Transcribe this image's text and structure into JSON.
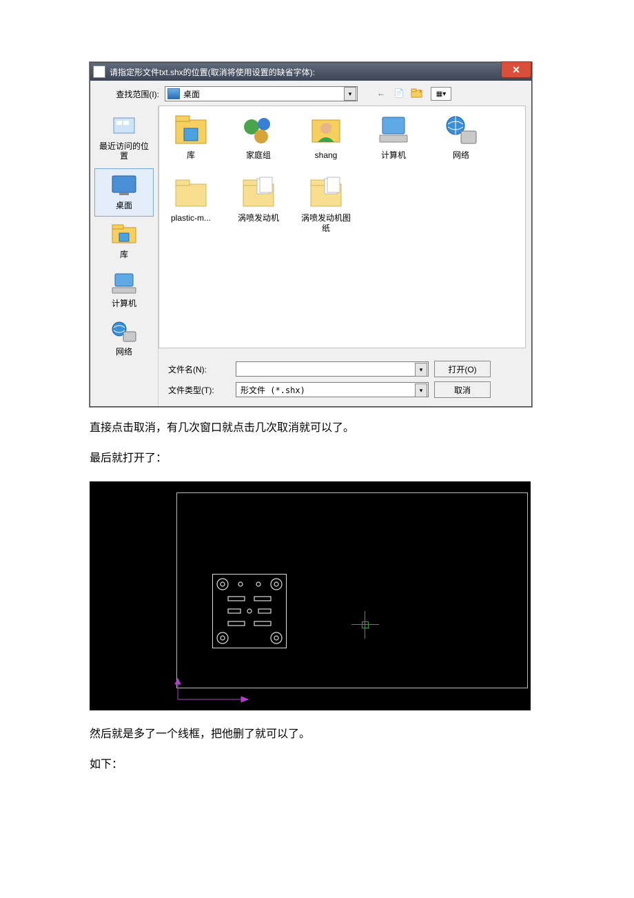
{
  "dialog": {
    "title": "请指定形文件txt.shx的位置(取消将使用设置的缺省字体):",
    "lookin_label": "查找范围(I):",
    "lookin_value": "桌面",
    "filename_label": "文件名(N):",
    "filename_value": "",
    "filetype_label": "文件类型(T):",
    "filetype_value": "形文件 (*.shx)",
    "open_btn": "打开(O)",
    "cancel_btn": "取消"
  },
  "places": [
    {
      "label": "最近访问的位置"
    },
    {
      "label": "桌面"
    },
    {
      "label": "库"
    },
    {
      "label": "计算机"
    },
    {
      "label": "网络"
    }
  ],
  "files": [
    {
      "label": "库"
    },
    {
      "label": "家庭组"
    },
    {
      "label": "shang"
    },
    {
      "label": "计算机"
    },
    {
      "label": "网络"
    },
    {
      "label": "plastic-m..."
    },
    {
      "label": "涡喷发动机"
    },
    {
      "label": "涡喷发动机图纸"
    }
  ],
  "paragraphs": {
    "p1": "直接点击取消，有几次窗口就点击几次取消就可以了。",
    "p2": "最后就打开了：",
    "p3": "然后就是多了一个线框，把他删了就可以了。",
    "p4": "如下："
  }
}
